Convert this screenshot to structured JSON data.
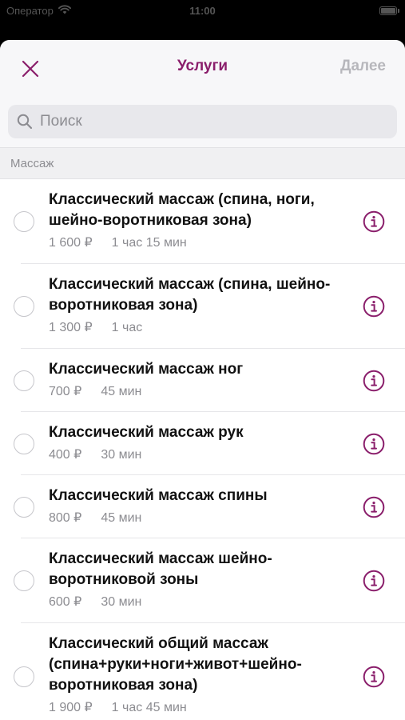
{
  "status_bar": {
    "carrier": "Оператор",
    "time": "11:00"
  },
  "nav": {
    "title": "Услуги",
    "next_label": "Далее"
  },
  "search": {
    "placeholder": "Поиск"
  },
  "section": {
    "title": "Массаж"
  },
  "services": [
    {
      "title": "Классический массаж (спина, ноги, шейно-воротниковая зона)",
      "price": "1 600 ₽",
      "duration": "1 час 15 мин"
    },
    {
      "title": "Классический массаж (спина, шейно-воротниковая зона)",
      "price": "1 300 ₽",
      "duration": "1 час"
    },
    {
      "title": "Классический массаж ног",
      "price": "700 ₽",
      "duration": "45 мин"
    },
    {
      "title": "Классический массаж рук",
      "price": "400 ₽",
      "duration": "30 мин"
    },
    {
      "title": "Классический массаж спины",
      "price": "800 ₽",
      "duration": "45 мин"
    },
    {
      "title": "Классический массаж шейно-воротниковой зоны",
      "price": "600 ₽",
      "duration": "30 мин"
    },
    {
      "title": "Классический общий массаж (спина+руки+ноги+живот+шейно-воротниковая зона)",
      "price": "1 900 ₽",
      "duration": "1 час 45 мин"
    }
  ],
  "colors": {
    "accent": "#8a1e6b",
    "disabled": "#b7b7bc",
    "secondary_text": "#8c8c91"
  },
  "icons": {
    "close": "close-icon",
    "search": "search-icon",
    "info": "info-icon",
    "wifi": "wifi-icon",
    "battery": "battery-icon"
  }
}
